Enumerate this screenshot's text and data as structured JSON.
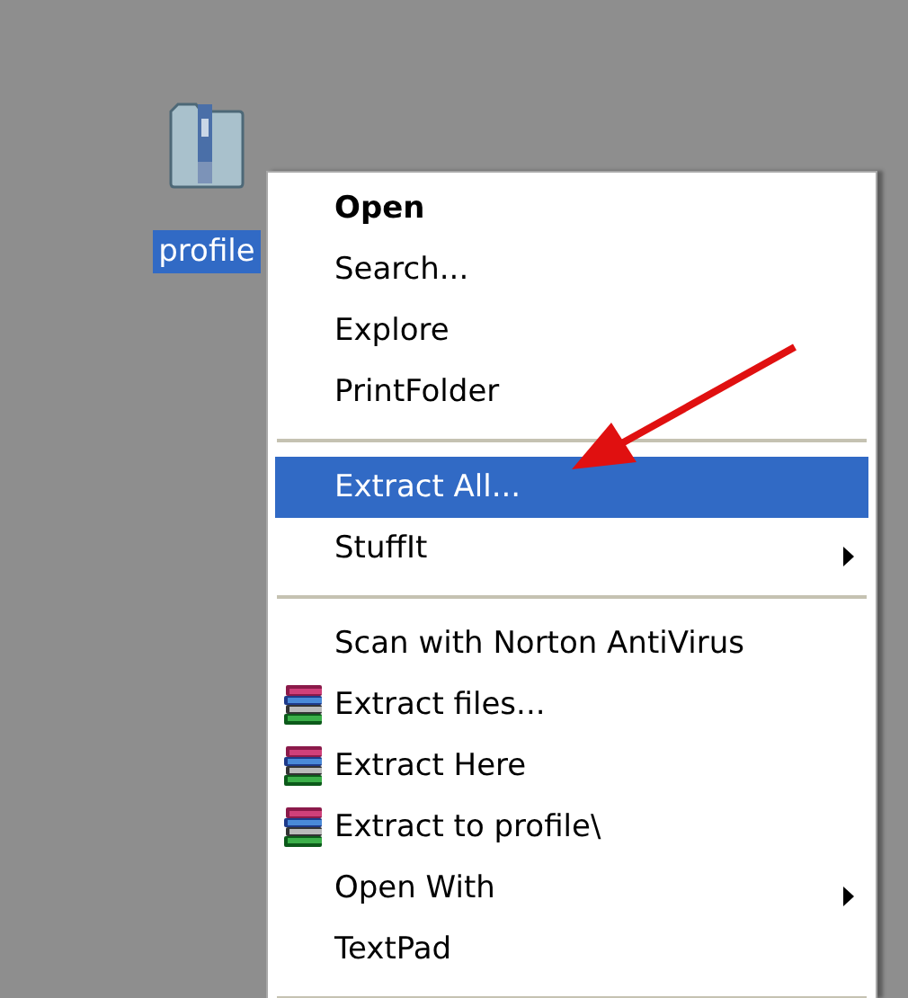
{
  "desktop_icon": {
    "label": "profile",
    "selected": true
  },
  "context_menu": {
    "items": [
      {
        "kind": "item",
        "label": "Open",
        "bold": true,
        "selected": false,
        "submenu": false,
        "icon": false
      },
      {
        "kind": "item",
        "label": "Search...",
        "bold": false,
        "selected": false,
        "submenu": false,
        "icon": false
      },
      {
        "kind": "item",
        "label": "Explore",
        "bold": false,
        "selected": false,
        "submenu": false,
        "icon": false
      },
      {
        "kind": "item",
        "label": "PrintFolder",
        "bold": false,
        "selected": false,
        "submenu": false,
        "icon": false
      },
      {
        "kind": "separator"
      },
      {
        "kind": "item",
        "label": "Extract All...",
        "bold": false,
        "selected": true,
        "submenu": false,
        "icon": false
      },
      {
        "kind": "item",
        "label": "StuffIt",
        "bold": false,
        "selected": false,
        "submenu": true,
        "icon": false
      },
      {
        "kind": "separator"
      },
      {
        "kind": "item",
        "label": "Scan with Norton AntiVirus",
        "bold": false,
        "selected": false,
        "submenu": false,
        "icon": false
      },
      {
        "kind": "item",
        "label": "Extract files...",
        "bold": false,
        "selected": false,
        "submenu": false,
        "icon": true
      },
      {
        "kind": "item",
        "label": "Extract Here",
        "bold": false,
        "selected": false,
        "submenu": false,
        "icon": true
      },
      {
        "kind": "item",
        "label": "Extract to profile\\",
        "bold": false,
        "selected": false,
        "submenu": false,
        "icon": true
      },
      {
        "kind": "item",
        "label": "Open With",
        "bold": false,
        "selected": false,
        "submenu": true,
        "icon": false
      },
      {
        "kind": "item",
        "label": "TextPad",
        "bold": false,
        "selected": false,
        "submenu": false,
        "icon": false
      },
      {
        "kind": "separator"
      }
    ]
  }
}
